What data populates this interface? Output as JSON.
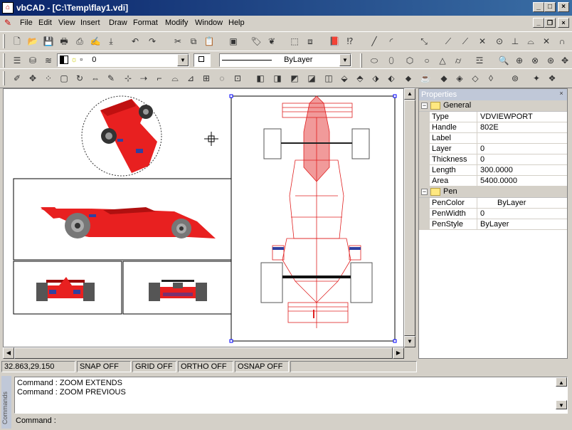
{
  "window": {
    "title": "vbCAD - [C:\\Temp\\flay1.vdi]"
  },
  "menu": [
    "File",
    "Edit",
    "View",
    "Insert",
    "Draw",
    "Format",
    "Modify",
    "Window",
    "Help"
  ],
  "layer_bar": {
    "layer_value": "0",
    "linetype_value": "ByLayer"
  },
  "properties": {
    "title": "Properties",
    "general": {
      "label": "General",
      "rows": [
        {
          "key": "Type",
          "value": "VDVIEWPORT"
        },
        {
          "key": "Handle",
          "value": "802E"
        },
        {
          "key": "Label",
          "value": ""
        },
        {
          "key": "Layer",
          "value": "0"
        },
        {
          "key": "Thickness",
          "value": "0"
        },
        {
          "key": "Length",
          "value": "300.0000"
        },
        {
          "key": "Area",
          "value": "5400.0000"
        }
      ]
    },
    "pen": {
      "label": "Pen",
      "rows": [
        {
          "key": "PenColor",
          "value": "ByLayer"
        },
        {
          "key": "PenWidth",
          "value": "0"
        },
        {
          "key": "PenStyle",
          "value": "ByLayer"
        }
      ]
    }
  },
  "status": {
    "coords": "32.863,29.150",
    "snap": "SNAP OFF",
    "grid": "GRID OFF",
    "ortho": "ORTHO OFF",
    "osnap": "OSNAP OFF"
  },
  "command": {
    "side_label": "Commands",
    "history": [
      "Command : ZOOM EXTENDS",
      "Command : ZOOM PREVIOUS"
    ],
    "prompt": "Command :"
  },
  "colors": {
    "title_start": "#0a246a",
    "title_end": "#3a6ea5",
    "car_red": "#e82020",
    "face": "#d4d0c8"
  }
}
